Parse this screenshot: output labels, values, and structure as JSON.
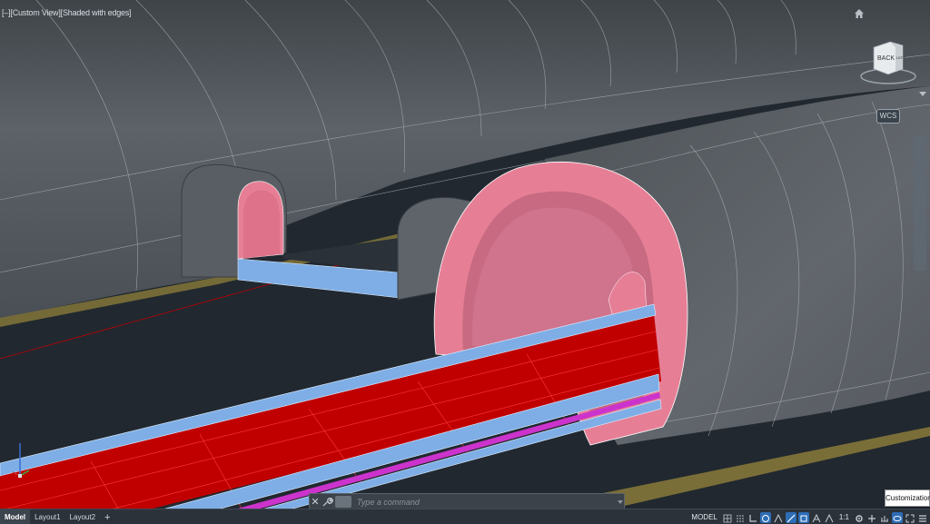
{
  "viewport": {
    "label": "[–][Custom View][Shaded with edges]",
    "wcs_label": "WCS",
    "viewcube": {
      "face_back": "BACK",
      "face_left": "LEFT"
    }
  },
  "command_line": {
    "placeholder": "Type a command"
  },
  "status_bar": {
    "tabs": [
      {
        "label": "Model",
        "active": true
      },
      {
        "label": "Layout1",
        "active": false
      },
      {
        "label": "Layout2",
        "active": false
      }
    ],
    "add_tab": "+",
    "space": "MODEL",
    "scale": "1:1"
  },
  "tooltip": {
    "text": "Customization"
  },
  "colors": {
    "background": "#212830",
    "tunnel": "#575c62",
    "lining": "#e67f95",
    "slab": "#c00000",
    "rails": "#7faee6",
    "magenta": "#cc33cc",
    "ground": "#a09050"
  }
}
